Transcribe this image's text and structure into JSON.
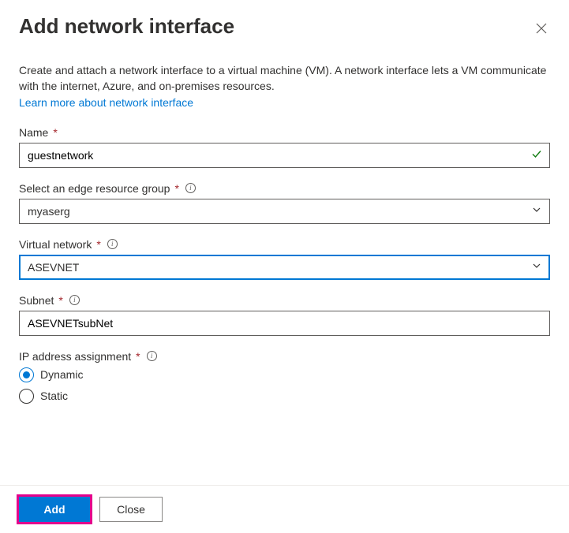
{
  "header": {
    "title": "Add network interface"
  },
  "intro": {
    "description": "Create and attach a network interface to a virtual machine (VM). A network interface lets a VM communicate with the internet, Azure, and on-premises resources.",
    "link_text": "Learn more about network interface"
  },
  "fields": {
    "name": {
      "label": "Name",
      "value": "guestnetwork"
    },
    "resource_group": {
      "label": "Select an edge resource group",
      "value": "myaserg"
    },
    "vnet": {
      "label": "Virtual network",
      "value": "ASEVNET"
    },
    "subnet": {
      "label": "Subnet",
      "value": "ASEVNETsubNet"
    },
    "ip_assignment": {
      "label": "IP address assignment",
      "options": {
        "dynamic": "Dynamic",
        "static": "Static"
      },
      "selected": "dynamic"
    }
  },
  "footer": {
    "add": "Add",
    "close": "Close"
  }
}
